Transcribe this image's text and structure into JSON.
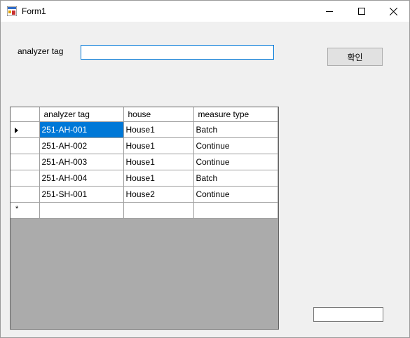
{
  "window": {
    "title": "Form1"
  },
  "form": {
    "label": "analyzer tag",
    "input_value": "",
    "confirm_label": "확인",
    "small_input_value": ""
  },
  "grid": {
    "columns": [
      "analyzer tag",
      "house",
      "measure type"
    ],
    "rows": [
      {
        "analyzer_tag": "251-AH-001",
        "house": "House1",
        "measure_type": "Batch"
      },
      {
        "analyzer_tag": "251-AH-002",
        "house": "House1",
        "measure_type": "Continue"
      },
      {
        "analyzer_tag": "251-AH-003",
        "house": "House1",
        "measure_type": "Continue"
      },
      {
        "analyzer_tag": "251-AH-004",
        "house": "House1",
        "measure_type": "Batch"
      },
      {
        "analyzer_tag": "251-SH-001",
        "house": "House2",
        "measure_type": "Continue"
      }
    ],
    "new_row_marker": "*"
  }
}
